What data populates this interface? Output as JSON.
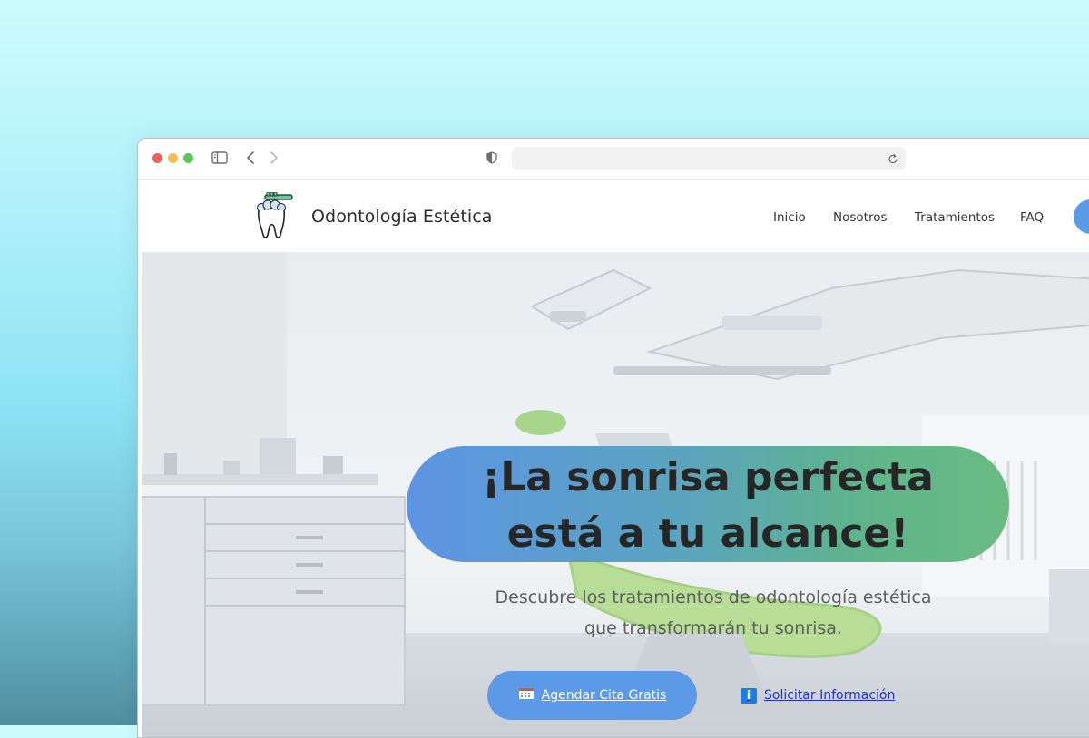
{
  "browser": {
    "icons": {
      "sidebar": "sidebar-icon",
      "back": "chevron-left-icon",
      "forward": "chevron-right-icon",
      "shield": "shield-icon",
      "reload": "reload-icon"
    },
    "address_value": ""
  },
  "site": {
    "brand": "Odontología Estética",
    "logo_icon": "tooth-toothbrush-icon",
    "nav": {
      "items": [
        {
          "label": "Inicio"
        },
        {
          "label": "Nosotros"
        },
        {
          "label": "Tratamientos"
        },
        {
          "label": "FAQ"
        }
      ]
    }
  },
  "hero": {
    "headline_line1": "¡La sonrisa perfecta",
    "headline_line2": "está a tu alcance!",
    "subtitle_line1": "Descubre los tratamientos de odontología estética",
    "subtitle_line2": "que transformarán tu sonrisa.",
    "primary_cta": {
      "label": "Agendar Cita Gratis",
      "icon": "calendar-icon"
    },
    "secondary_cta": {
      "label": "Solicitar Información",
      "icon": "info-icon"
    }
  },
  "colors": {
    "accent_blue": "#5c99e7",
    "accent_green": "#6bbb83",
    "link_blue": "#1f2fd6",
    "headline_text": "#262626"
  }
}
